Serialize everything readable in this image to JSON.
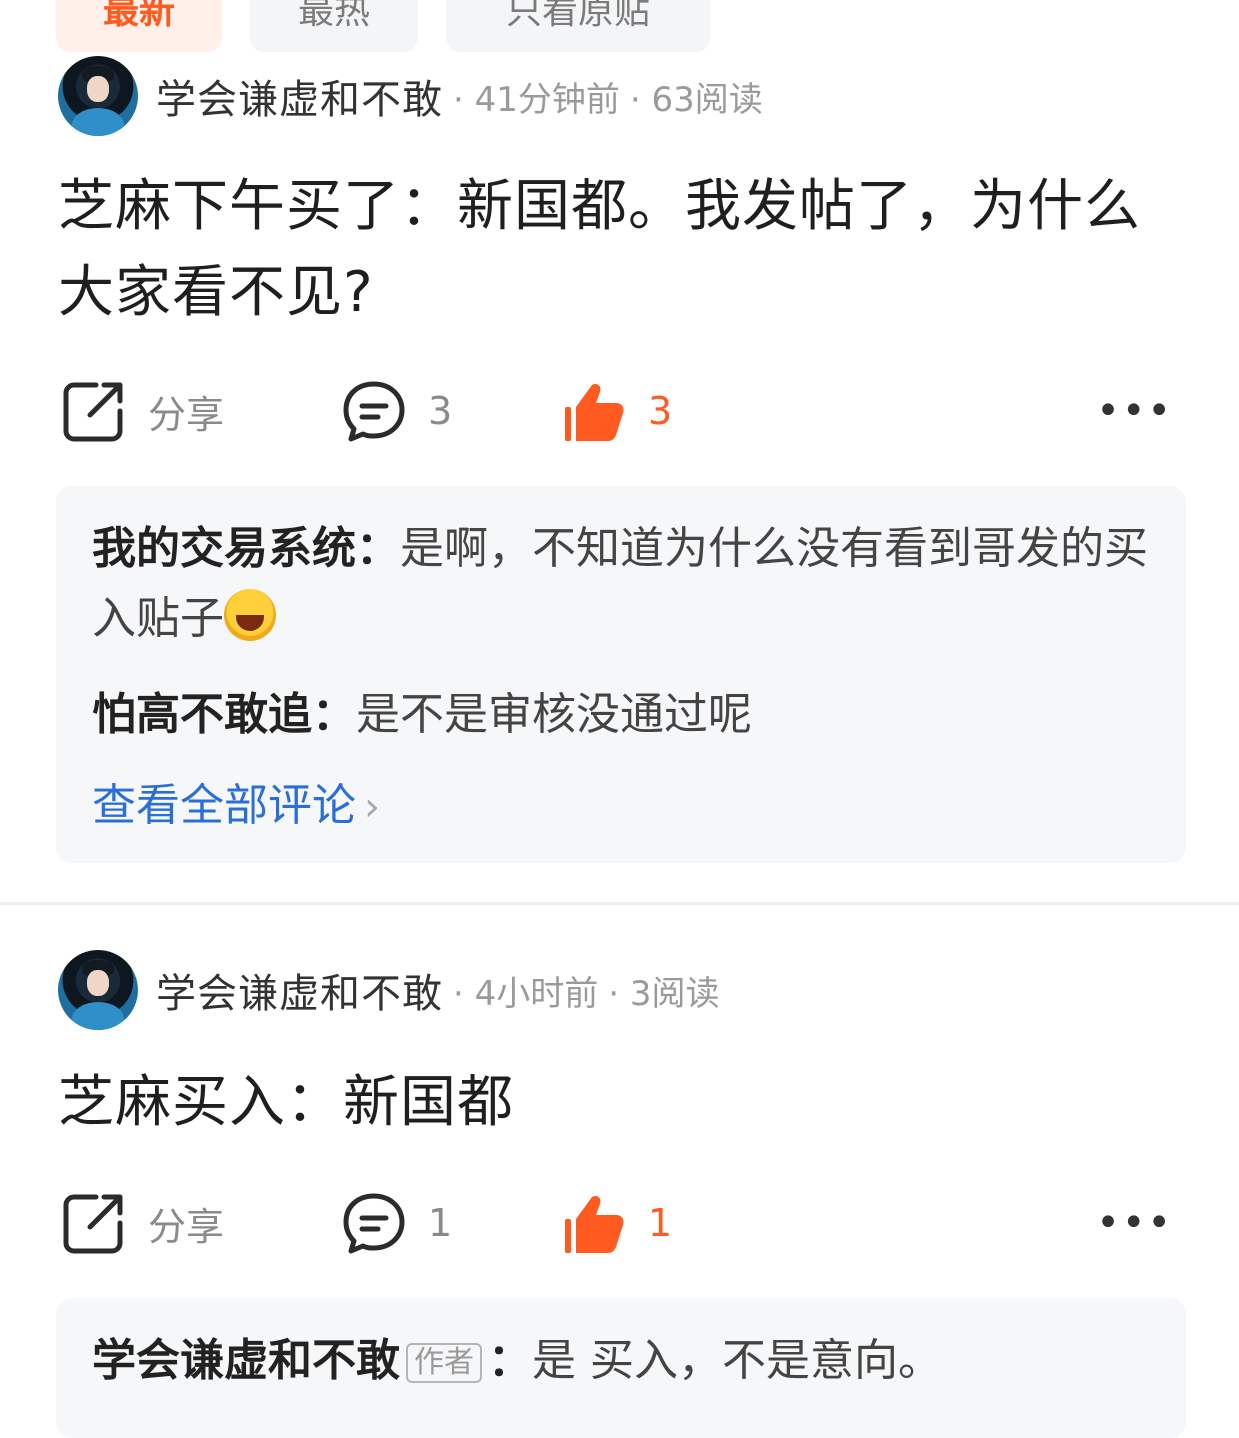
{
  "tabs": [
    {
      "label": "最新",
      "active": true
    },
    {
      "label": "最热",
      "active": false
    },
    {
      "label": "只看原贴",
      "active": false
    }
  ],
  "posts": [
    {
      "author": "学会谦虚和不敢",
      "time": "· 41分钟前",
      "reads": "· 63阅读",
      "content": "芝麻下午买了：新国都。我发帖了，为什么大家看不见?",
      "share_label": "分享",
      "comment_count": "3",
      "like_count": "3",
      "comments": [
        {
          "who": "我的交易系统",
          "sep": "：",
          "text": "是啊，不知道为什么没有看到哥发的买入贴子",
          "emoji": "rolling-laughing-emoji"
        },
        {
          "who": "怕高不敢追",
          "sep": "：",
          "text": "是不是审核没通过呢"
        }
      ],
      "see_all": "查看全部评论"
    },
    {
      "author": "学会谦虚和不敢",
      "time": "· 4小时前",
      "reads": "· 3阅读",
      "content": "芝麻买入：新国都",
      "share_label": "分享",
      "comment_count": "1",
      "like_count": "1",
      "comments": [
        {
          "who": "学会谦虚和不敢",
          "badge": "作者",
          "sep": "：",
          "text": "是 买入，不是意向。"
        }
      ]
    }
  ],
  "colors": {
    "accent": "#ff5a1f",
    "link": "#2b6fd6",
    "comment_bg": "#f6f7f9"
  },
  "icons": {
    "share": "share-icon",
    "comment": "comment-icon",
    "like": "thumbs-up-icon",
    "more": "more-icon"
  }
}
